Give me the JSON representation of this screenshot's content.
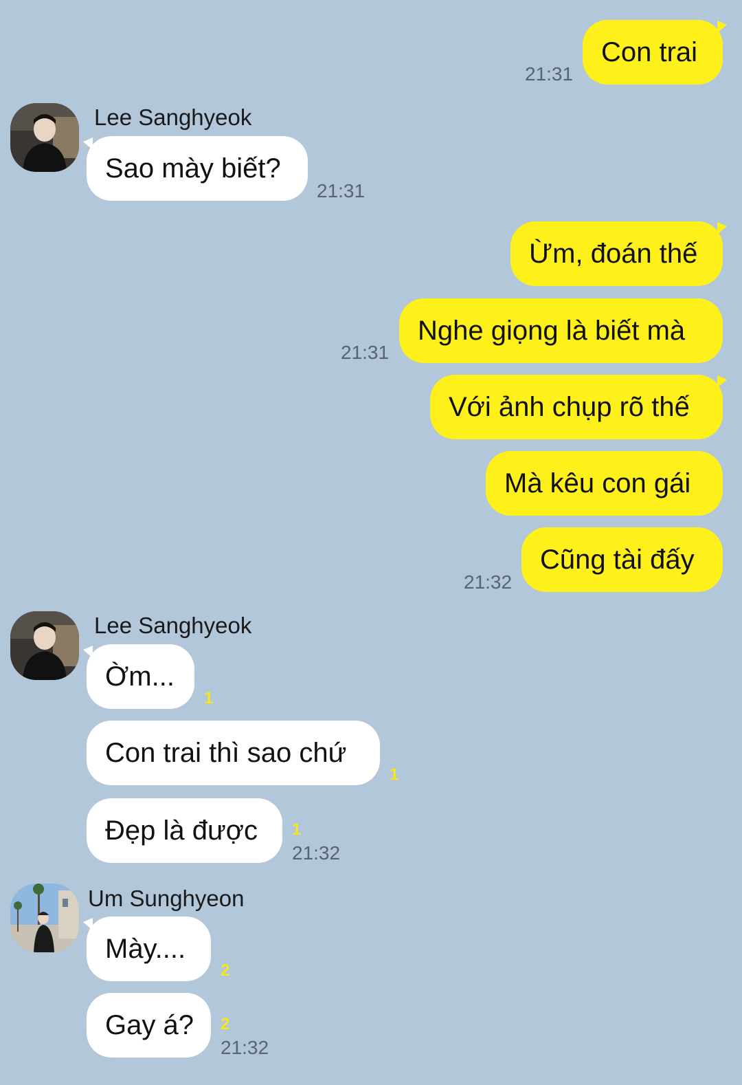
{
  "messages": {
    "m1": "Con trai",
    "m2": "Sao mày biết?",
    "m3": "Ừm, đoán thế",
    "m4": "Nghe giọng là biết mà",
    "m5": "Với ảnh chụp rõ thế",
    "m6": "Mà kêu con gái",
    "m7": "Cũng tài đấy",
    "m8": "Ờm...",
    "m9": "Con trai thì sao chứ",
    "m10": "Đẹp là được",
    "m11": "Mày....",
    "m12": "Gay á?"
  },
  "senders": {
    "s1": "Lee Sanghyeok",
    "s2": "Lee Sanghyeok",
    "s3": "Um Sunghyeon"
  },
  "times": {
    "t1": "21:31",
    "t2": "21:31",
    "t3": "21:31",
    "t4": "21:32",
    "t5": "21:32",
    "t6": "21:32"
  },
  "unread": {
    "u1": "1",
    "u2": "1",
    "u3": "1",
    "u4": "2",
    "u5": "2"
  },
  "colors": {
    "background": "#b2c7da",
    "my_bubble": "#fef01b",
    "their_bubble": "#ffffff",
    "unread_count": "#f5e61e"
  }
}
